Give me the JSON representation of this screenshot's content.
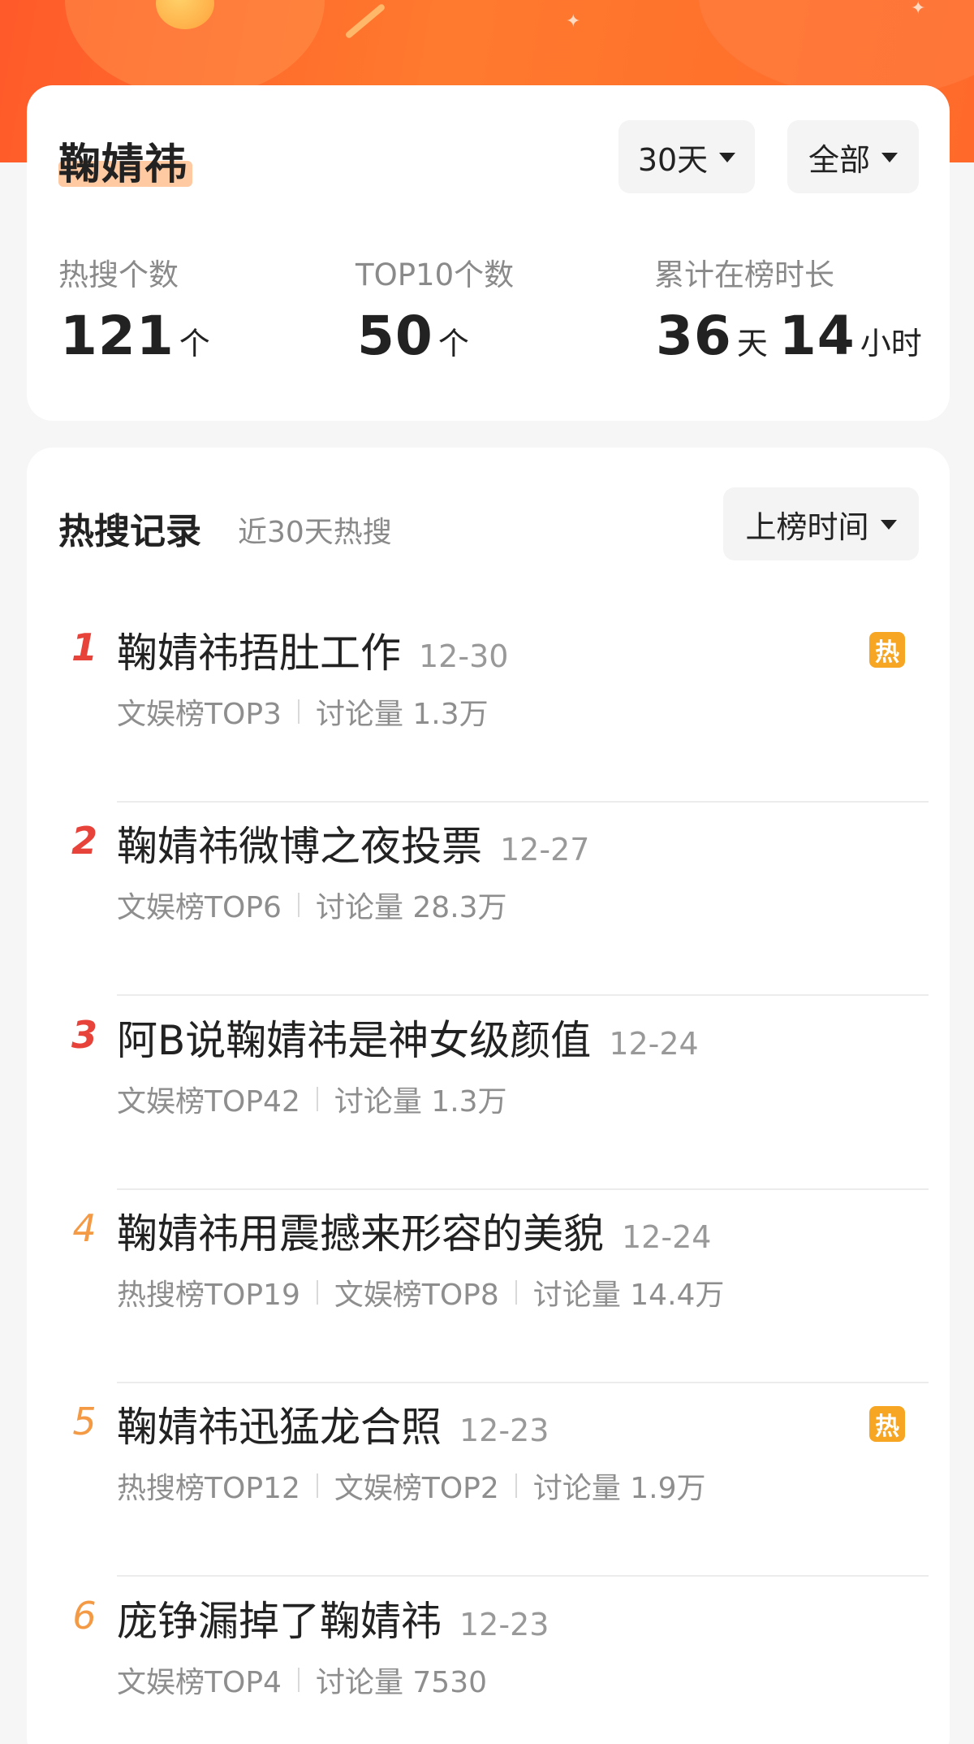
{
  "header": {
    "name": "鞠婧祎",
    "period_filter": "30天",
    "scope_filter": "全部"
  },
  "stats": [
    {
      "label": "热搜个数",
      "value": "121",
      "unit": "个"
    },
    {
      "label": "TOP10个数",
      "value": "50",
      "unit": "个"
    },
    {
      "label": "累计在榜时长",
      "days": "36",
      "days_unit": "天",
      "hours": "14",
      "hours_unit": "小时"
    }
  ],
  "records": {
    "title": "热搜记录",
    "subtitle": "近30天热搜",
    "sort_label": "上榜时间",
    "items": [
      {
        "rank": "1",
        "title": "鞠婧祎捂肚工作",
        "date": "12-30",
        "meta": [
          "文娱榜TOP3",
          "讨论量 1.3万"
        ],
        "hot": "热"
      },
      {
        "rank": "2",
        "title": "鞠婧祎微博之夜投票",
        "date": "12-27",
        "meta": [
          "文娱榜TOP6",
          "讨论量 28.3万"
        ],
        "hot": ""
      },
      {
        "rank": "3",
        "title": "阿B说鞠婧祎是神女级颜值",
        "date": "12-24",
        "meta": [
          "文娱榜TOP42",
          "讨论量 1.3万"
        ],
        "hot": ""
      },
      {
        "rank": "4",
        "title": "鞠婧祎用震撼来形容的美貌",
        "date": "12-24",
        "meta": [
          "热搜榜TOP19",
          "文娱榜TOP8",
          "讨论量 14.4万"
        ],
        "hot": ""
      },
      {
        "rank": "5",
        "title": "鞠婧祎迅猛龙合照",
        "date": "12-23",
        "meta": [
          "热搜榜TOP12",
          "文娱榜TOP2",
          "讨论量 1.9万"
        ],
        "hot": "热"
      },
      {
        "rank": "6",
        "title": "庞铮漏掉了鞠婧祎",
        "date": "12-23",
        "meta": [
          "文娱榜TOP4",
          "讨论量 7530"
        ],
        "hot": ""
      }
    ]
  },
  "colors": {
    "header_orange": "#ff6a2b",
    "rank_top3": "#e8433a",
    "rank_other": "#f49a45",
    "hot_badge": "#f6a623"
  }
}
